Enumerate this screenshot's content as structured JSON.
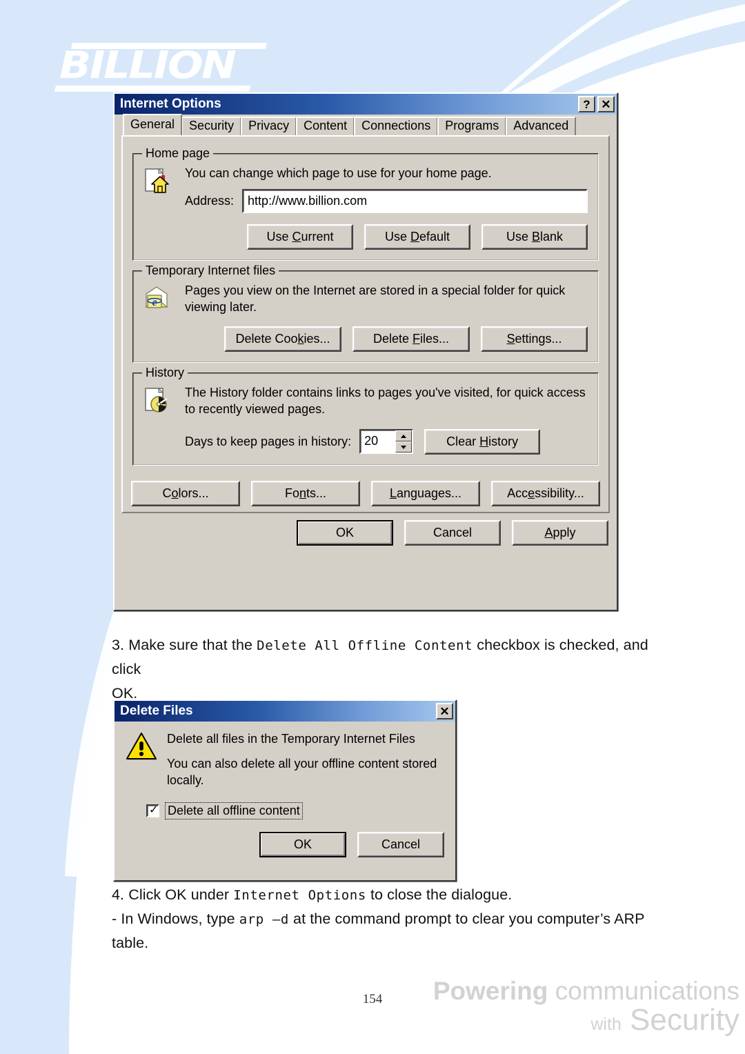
{
  "brand": {
    "logo_text": "BILLION",
    "footer_line1_bold": "Powering",
    "footer_line1_light": "communications",
    "footer_line2_small": "with",
    "footer_line2_large": "Security",
    "page_number": "154",
    "accent_blue": "#d8e8fa",
    "titlebar_navy": "#0a246a",
    "dialog_face": "#d4d0c8"
  },
  "internet_options": {
    "title": "Internet Options",
    "help_button": "?",
    "close_button": "✕",
    "tabs": [
      {
        "label": "General",
        "active": true
      },
      {
        "label": "Security",
        "active": false
      },
      {
        "label": "Privacy",
        "active": false
      },
      {
        "label": "Content",
        "active": false
      },
      {
        "label": "Connections",
        "active": false
      },
      {
        "label": "Programs",
        "active": false
      },
      {
        "label": "Advanced",
        "active": false
      }
    ],
    "home_page": {
      "group_label": "Home page",
      "icon": "home-page-icon",
      "description": "You can change which page to use for your home page.",
      "address_label": "Address:",
      "address_value": "http://www.billion.com",
      "buttons": [
        {
          "label": "Use Current",
          "accel": "C"
        },
        {
          "label": "Use Default",
          "accel": "D"
        },
        {
          "label": "Use Blank",
          "accel": "B"
        }
      ]
    },
    "temporary_internet_files": {
      "group_label": "Temporary Internet files",
      "icon": "temp-files-icon",
      "description": "Pages you view on the Internet are stored in a special folder for quick viewing later.",
      "buttons": [
        {
          "label": "Delete Cookies...",
          "accel": "k"
        },
        {
          "label": "Delete Files...",
          "accel": "F"
        },
        {
          "label": "Settings...",
          "accel": "S"
        }
      ]
    },
    "history": {
      "group_label": "History",
      "icon": "history-icon",
      "description": "The History folder contains links to pages you've visited, for quick access to recently viewed pages.",
      "days_label": "Days to keep pages in history:",
      "days_value": "20",
      "clear_button": "Clear History",
      "clear_button_accel": "H"
    },
    "option_buttons": [
      {
        "label": "Colors...",
        "accel": "o"
      },
      {
        "label": "Fonts...",
        "accel": "n"
      },
      {
        "label": "Languages...",
        "accel": "L"
      },
      {
        "label": "Accessibility...",
        "accel": "e"
      }
    ],
    "footer_buttons": [
      {
        "label": "OK",
        "default": true
      },
      {
        "label": "Cancel",
        "default": false
      },
      {
        "label": "Apply",
        "accel": "A",
        "default": false
      }
    ]
  },
  "delete_files": {
    "title": "Delete Files",
    "close_button": "✕",
    "icon": "warning-triangle-icon",
    "message_line1": "Delete all files in the Temporary Internet Files",
    "message_line2": "You can also delete all your offline content stored locally.",
    "checkbox_label": "Delete all offline content",
    "checkbox_checked": true,
    "buttons": [
      {
        "label": "OK",
        "default": true
      },
      {
        "label": "Cancel",
        "default": false
      }
    ]
  },
  "instructions": {
    "step3_part1": "3. Make sure that the ",
    "step3_mono": "Delete All Offline Content",
    "step3_part2": " checkbox is checked, and click",
    "step3_line2": "OK.",
    "step4_part1": "4. Click OK under ",
    "step4_mono": "Internet Options",
    "step4_part2": " to close the dialogue.",
    "step5_part1": "- In Windows, type ",
    "step5_mono": "arp –d",
    "step5_part2": " at the command prompt to clear you computer’s ARP",
    "step5_line2": "table."
  }
}
